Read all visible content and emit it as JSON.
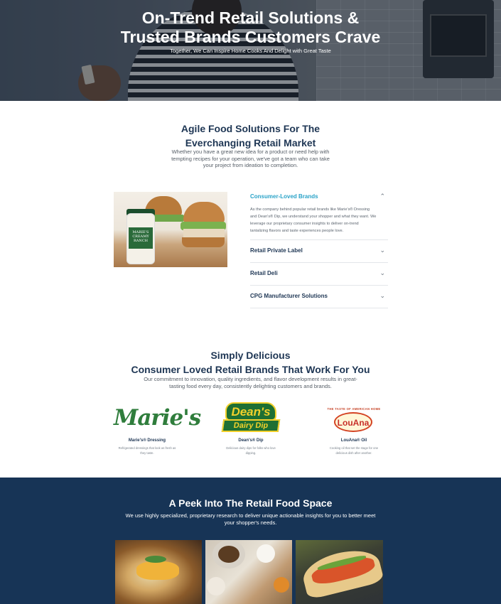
{
  "hero": {
    "title_line1": "On-Trend Retail Solutions &",
    "title_line2": "Trusted Brands Customers Crave",
    "subtitle": "Together, We Can Inspire Home Cooks And Delight with Great Taste"
  },
  "agile": {
    "title_line1": "Agile Food Solutions For The",
    "title_line2": "Everchanging Retail Market",
    "desc_line1": "Whether you have a great new idea for a product or need help with",
    "desc_line2": "tempting recipes for your operation, we've got a team who can take",
    "desc_line3": "your project from ideation to completion.",
    "image_label": "MARIE'S CREAMY RANCH"
  },
  "accordion": {
    "items": [
      {
        "title": "Consumer-Loved Brands",
        "icon": "chevron-up-icon",
        "open": true
      },
      {
        "title": "Retail Private Label",
        "icon": "chevron-down-icon",
        "open": false
      },
      {
        "title": "Retail Deli",
        "icon": "chevron-down-icon",
        "open": false
      },
      {
        "title": "CPG Manufacturer Solutions",
        "icon": "chevron-down-icon",
        "open": false
      }
    ],
    "open_body_line1": "As the company behind popular retail brands like Marie's® Dressing",
    "open_body_line2": "and Dean's® Dip, we understand your shopper and what they want. We",
    "open_body_line3": "leverage our proprietary consumer insights to deliver on-trend",
    "open_body_line4": "tantalizing flavors and taste experiences people love.",
    "accent_color": "#2aa3c8"
  },
  "brands_section": {
    "title_line1": "Simply Delicious",
    "title_line2": "Consumer Loved Retail Brands That Work For You",
    "desc_line1": "Our commitment to innovation, quality ingredients, and flavor development results in great-",
    "desc_line2": "tasting food every day, consistently delighting customers and brands.",
    "brands": [
      {
        "logo_text": "Marie's",
        "name": "Marie's® Dressing",
        "desc_line1": "Refrigerated dressings that look as fresh as",
        "desc_line2": "they taste."
      },
      {
        "logo_text_top": "Dean's",
        "logo_text_bottom": "Dairy Dip",
        "name": "Dean's® Dip",
        "desc_line1": "Delicious dairy dips for folks who love",
        "desc_line2": "dipping."
      },
      {
        "logo_arc": "THE TASTE OF AMERICAN HOME",
        "logo_text": "LouAna",
        "name": "LouAna® Oil",
        "desc_line1": "Cooking oil that set the stage for one",
        "desc_line2": "delicious dish after another."
      }
    ]
  },
  "peek": {
    "title": "A Peek Into The Retail Food Space",
    "desc_line1": "We use highly specialized, proprietary research to deliver unique actionable insights for you to better meet",
    "desc_line2": "your shopper's needs.",
    "bg_color": "#173456"
  }
}
